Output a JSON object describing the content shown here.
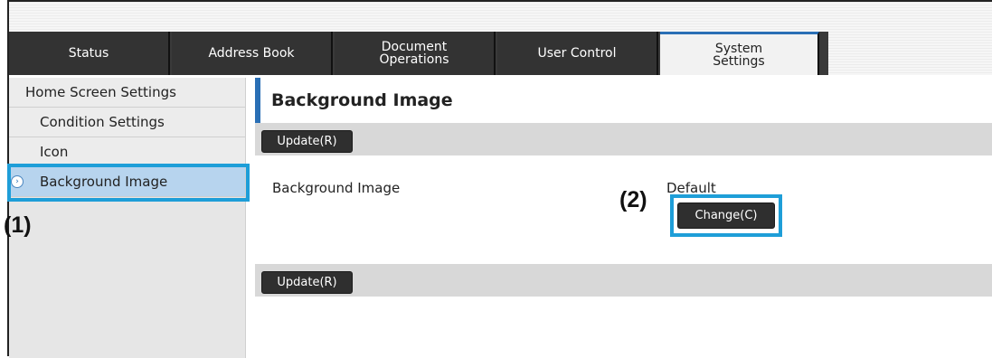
{
  "tabs": [
    {
      "label": "Status"
    },
    {
      "label": "Address Book"
    },
    {
      "label": "Document\nOperations"
    },
    {
      "label": "User Control"
    },
    {
      "label": "System\nSettings"
    }
  ],
  "sidebar": {
    "items": [
      {
        "label": "Home Screen Settings"
      },
      {
        "label": "Condition Settings"
      },
      {
        "label": "Icon"
      },
      {
        "label": "Background Image"
      }
    ]
  },
  "page": {
    "title": "Background Image",
    "update_label_top": "Update(R)",
    "update_label_bottom": "Update(R)",
    "field_label": "Background Image",
    "field_value": "Default",
    "change_label": "Change(C)"
  },
  "annotations": {
    "callout1": "(1)",
    "callout2": "(2)",
    "highlight_color": "#1e9ed8"
  },
  "colors": {
    "accent": "#2a6fb5",
    "tab_bg": "#333333",
    "selected_item_bg": "#b7d4ee"
  }
}
